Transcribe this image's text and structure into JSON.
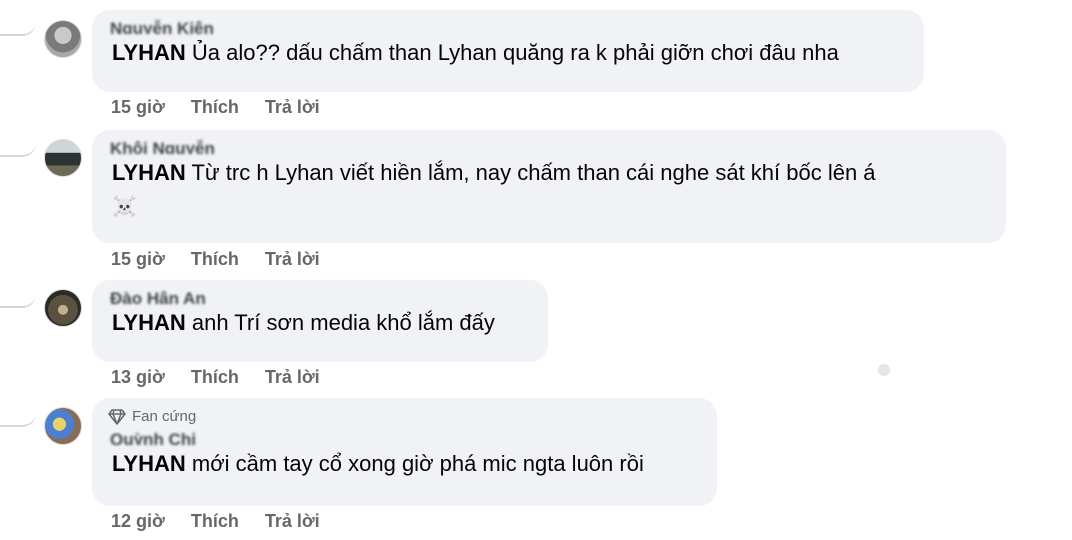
{
  "comments": [
    {
      "author": "Nguyễn Kiên",
      "mention": "LYHAN",
      "text": "Ủa alo?? dấu chấm than Lyhan quăng ra k phải giỡn chơi đâu nha",
      "time": "15 giờ",
      "like": "Thích",
      "reply": "Trả lời"
    },
    {
      "author": "Khôi Nguyễn",
      "mention": "LYHAN",
      "text": "Từ trc h Lyhan viết hiền lắm, nay chấm than cái nghe sát khí bốc lên á",
      "emoji": "☠️",
      "time": "15 giờ",
      "like": "Thích",
      "reply": "Trả lời"
    },
    {
      "author": "Đào Hân An",
      "mention": "LYHAN",
      "text": "anh Trí sơn media khổ lắm đấy",
      "time": "13 giờ",
      "like": "Thích",
      "reply": "Trả lời"
    },
    {
      "badge": "Fan cứng",
      "badge_icon": "diamond-icon",
      "author": "Quỳnh Chi",
      "mention": "LYHAN",
      "text": "mới cầm tay cổ xong giờ phá mic ngta luôn rồi",
      "time": "12 giờ",
      "like": "Thích",
      "reply": "Trả lời"
    }
  ]
}
